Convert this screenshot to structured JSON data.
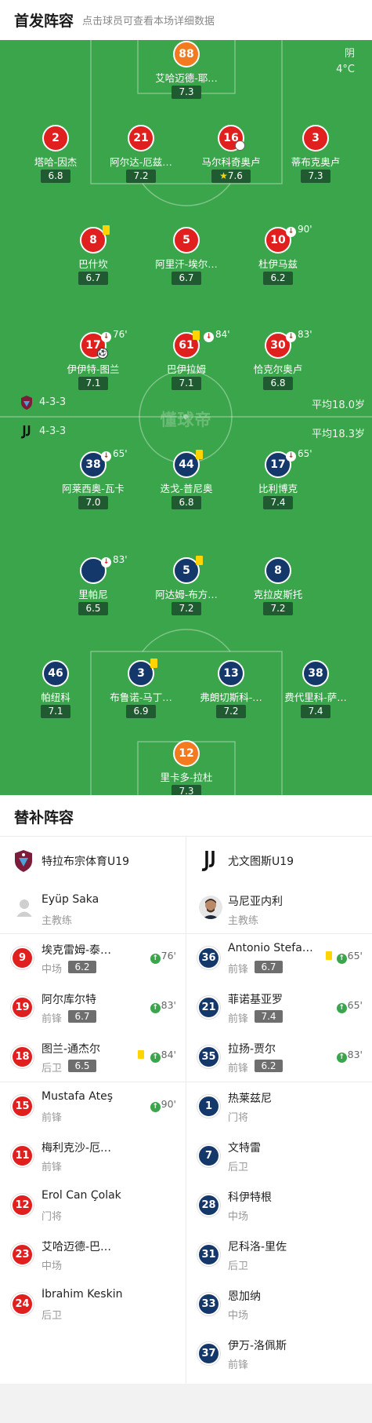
{
  "header": {
    "title": "首发阵容",
    "subtitle": "点击球员可查看本场详细数据"
  },
  "weather": {
    "condition": "阴",
    "temp": "4°C"
  },
  "watermark": "懂球帝",
  "home_formation": {
    "formation": "4-3-3",
    "avg_age": "平均18.0岁"
  },
  "away_formation": {
    "formation": "4-3-3",
    "avg_age": "平均18.3岁"
  },
  "home_players": [
    {
      "num": "88",
      "name": "艾哈迈德-耶…",
      "rating": "7.3"
    },
    {
      "num": "2",
      "name": "塔哈-因杰",
      "rating": "6.8"
    },
    {
      "num": "21",
      "name": "阿尔达-厄兹…",
      "rating": "7.2"
    },
    {
      "num": "16",
      "name": "马尔科奇奥卢",
      "rating": "7.6"
    },
    {
      "num": "3",
      "name": "蒂布克奥卢",
      "rating": "7.3"
    },
    {
      "num": "8",
      "name": "巴什坎",
      "rating": "6.7"
    },
    {
      "num": "5",
      "name": "阿里汗-埃尔…",
      "rating": "6.7"
    },
    {
      "num": "10",
      "name": "杜伊马兹",
      "rating": "6.2",
      "sub": "90'"
    },
    {
      "num": "17",
      "name": "伊伊特-图兰",
      "rating": "7.1",
      "sub": "76'"
    },
    {
      "num": "61",
      "name": "巴伊拉姆",
      "rating": "7.1",
      "sub": "84'"
    },
    {
      "num": "30",
      "name": "恰克尔奥卢",
      "rating": "6.8",
      "sub": "83'"
    }
  ],
  "away_players": [
    {
      "num": "38",
      "name": "阿莱西奥-瓦卡",
      "rating": "7.0",
      "sub": "65'"
    },
    {
      "num": "44",
      "name": "迭戈-普尼奥",
      "rating": "6.8"
    },
    {
      "num": "17",
      "name": "比利博克",
      "rating": "7.4",
      "sub": "65'"
    },
    {
      "num": "",
      "name": "里帕尼",
      "rating": "6.5",
      "sub": "83'"
    },
    {
      "num": "5",
      "name": "阿达姆-布方…",
      "rating": "7.2"
    },
    {
      "num": "8",
      "name": "克拉皮斯托",
      "rating": "7.2"
    },
    {
      "num": "46",
      "name": "帕纽科",
      "rating": "7.1"
    },
    {
      "num": "3",
      "name": "布鲁诺-马丁…",
      "rating": "6.9"
    },
    {
      "num": "13",
      "name": "弗朗切斯科-…",
      "rating": "7.2"
    },
    {
      "num": "38",
      "name": "费代里科-萨…",
      "rating": "7.4"
    },
    {
      "num": "12",
      "name": "里卡多-拉杜",
      "rating": "7.3"
    }
  ],
  "subs": {
    "title": "替补阵容",
    "home": {
      "team": "特拉布宗体育U19",
      "coach": {
        "name": "Eyüp Saka",
        "role": "主教练"
      },
      "players": [
        {
          "num": "9",
          "name": "埃克雷姆-泰…",
          "pos": "中场",
          "rating": "6.2",
          "in": "76'"
        },
        {
          "num": "19",
          "name": "阿尔库尔特",
          "pos": "前锋",
          "rating": "6.7",
          "in": "83'"
        },
        {
          "num": "18",
          "name": "图兰-通杰尔",
          "pos": "后卫",
          "rating": "6.5",
          "in": "84'"
        },
        {
          "num": "15",
          "name": "Mustafa Ateş",
          "pos": "前锋",
          "in": "90'"
        },
        {
          "num": "11",
          "name": "梅利克沙-厄…",
          "pos": "前锋"
        },
        {
          "num": "12",
          "name": "Erol Can Çolak",
          "pos": "门将"
        },
        {
          "num": "23",
          "name": "艾哈迈德-巴…",
          "pos": "中场"
        },
        {
          "num": "24",
          "name": "İbrahim Keskin",
          "pos": "后卫"
        }
      ]
    },
    "away": {
      "team": "尤文图斯U19",
      "coach": {
        "name": "马尼亚内利",
        "role": "主教练"
      },
      "players": [
        {
          "num": "36",
          "name": "Antonio Stefa…",
          "pos": "前锋",
          "rating": "6.7",
          "in": "65'"
        },
        {
          "num": "21",
          "name": "菲诺基亚罗",
          "pos": "前锋",
          "rating": "7.4",
          "in": "65'"
        },
        {
          "num": "35",
          "name": "拉扬-贾尔",
          "pos": "前锋",
          "rating": "6.2",
          "in": "83'"
        },
        {
          "num": "1",
          "name": "热莱兹尼",
          "pos": "门将"
        },
        {
          "num": "7",
          "name": "文特雷",
          "pos": "后卫"
        },
        {
          "num": "28",
          "name": "科伊特根",
          "pos": "中场"
        },
        {
          "num": "31",
          "name": "尼科洛-里佐",
          "pos": "后卫"
        },
        {
          "num": "33",
          "name": "恩加纳",
          "pos": "中场"
        },
        {
          "num": "37",
          "name": "伊万-洛佩斯",
          "pos": "前锋"
        }
      ]
    }
  },
  "colors": {
    "pitch": "#3aa54a",
    "home": "#e01f1f",
    "away": "#15386a",
    "keeper": "#f47a20",
    "rating_bg": "#1f5a31"
  }
}
